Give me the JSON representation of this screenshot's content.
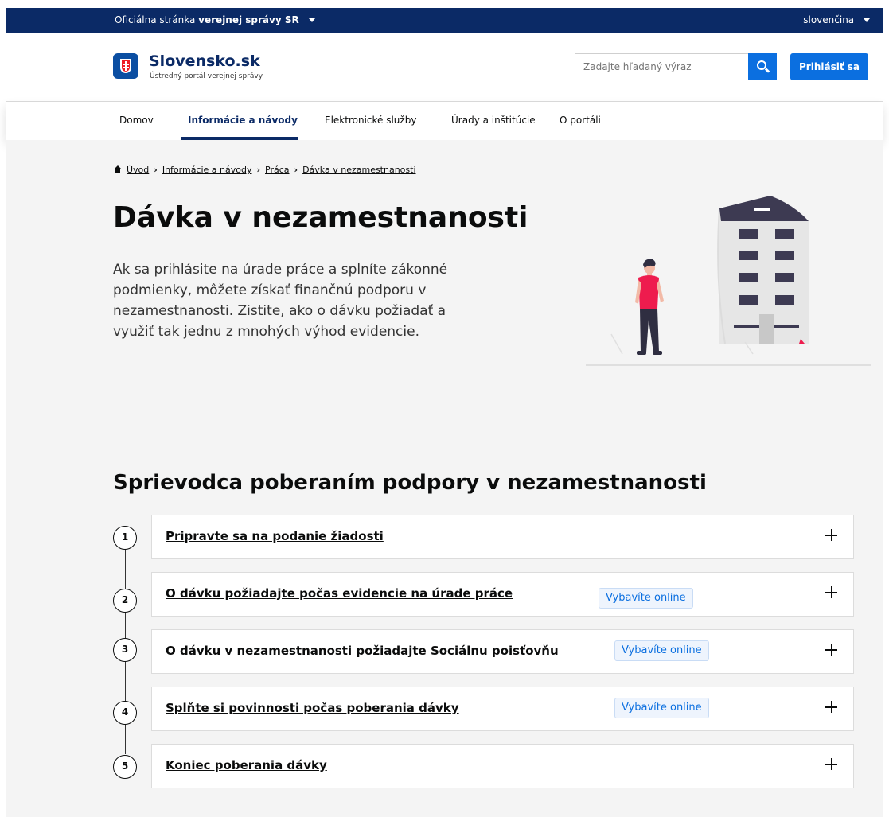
{
  "topbar": {
    "official_prefix": "Oficiálna stránka",
    "official_strong": "verejnej správy SR",
    "language": "slovenčina"
  },
  "header": {
    "logo_name": "Slovensko.sk",
    "logo_sub": "Ústredný portál verejnej správy",
    "search_placeholder": "Zadajte hľadaný výraz",
    "login_label": "Prihlásiť sa"
  },
  "nav": {
    "items": [
      {
        "label": "Domov"
      },
      {
        "label": "Informácie a návody",
        "active": true
      },
      {
        "label": "Elektronické služby"
      },
      {
        "label": "Úrady a inštitúcie"
      },
      {
        "label": "O portáli"
      }
    ]
  },
  "breadcrumb": [
    "Úvod",
    "Informácie a návody",
    "Práca",
    "Dávka v nezamestnanosti"
  ],
  "page": {
    "title": "Dávka v nezamestnanosti",
    "lead": "Ak sa prihlásite na úrade práce a splníte zákonné podmienky, môžete získať finančnú podporu v nezamestnanosti. Zistite, ako o dávku požiadať a využiť tak jednu z mnohých výhod evidencie."
  },
  "guide": {
    "title": "Sprievodca poberaním podpory v nezamestnanosti",
    "steps": [
      {
        "number": "1",
        "label": "Pripravte sa na podanie žiadosti",
        "badge": ""
      },
      {
        "number": "2",
        "label": "O dávku požiadajte počas evidencie na úrade práce",
        "badge": "Vybavíte online"
      },
      {
        "number": "3",
        "label": "O dávku v nezamestnanosti požiadajte Sociálnu poisťovňu",
        "badge": "Vybavíte online"
      },
      {
        "number": "4",
        "label": "Splňte si povinnosti počas poberania dávky",
        "badge": "Vybavíte online"
      },
      {
        "number": "5",
        "label": "Koniec poberania dávky",
        "badge": ""
      }
    ]
  },
  "colors": {
    "brand_navy": "#0b2a66",
    "accent_blue": "#0b6fe0",
    "page_bg": "#f4f4f4"
  },
  "icons": [
    "caret-down-icon",
    "coat-of-arms-icon",
    "search-icon",
    "home-icon",
    "plus-icon"
  ]
}
